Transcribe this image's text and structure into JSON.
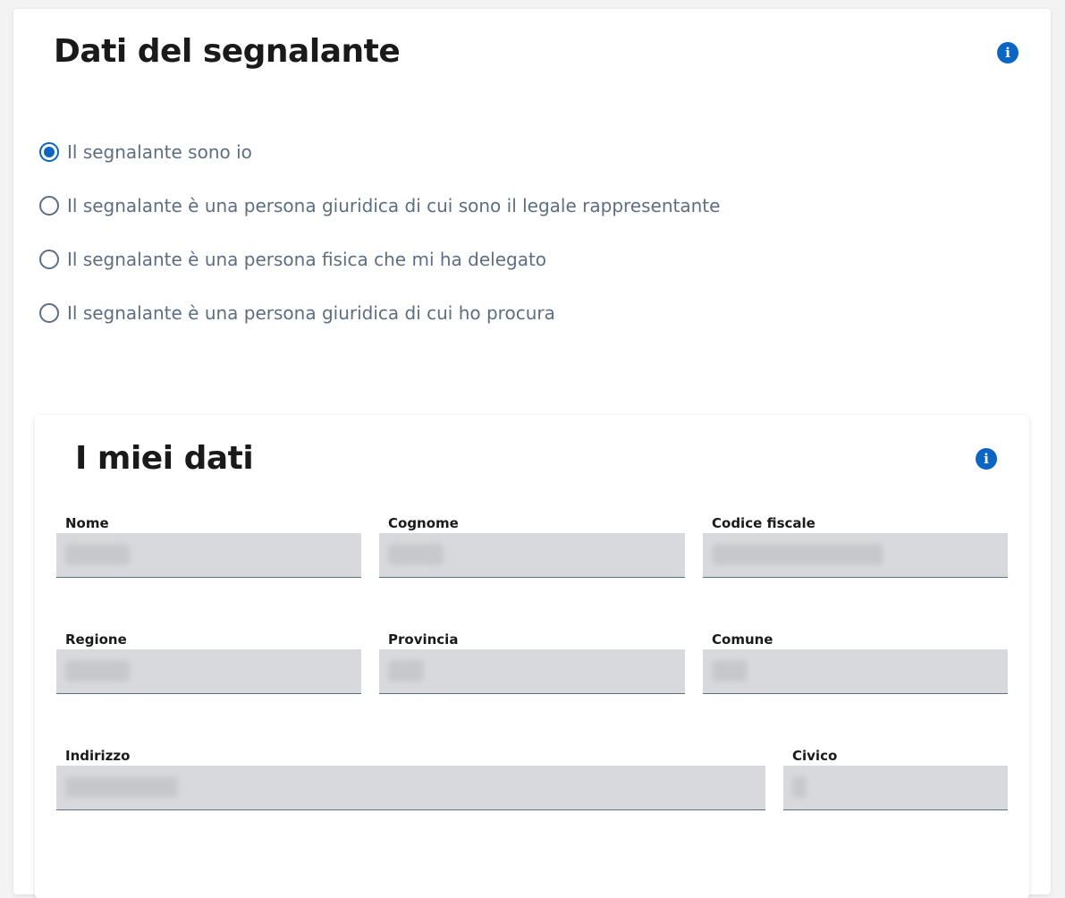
{
  "outer_section": {
    "title": "Dati del segnalante",
    "info_icon": "info-icon"
  },
  "reporter_options": [
    {
      "label": "Il segnalante sono io",
      "checked": true
    },
    {
      "label": "Il segnalante è una persona giuridica di cui sono il legale rappresentante",
      "checked": false
    },
    {
      "label": "Il segnalante è una persona fisica che mi ha delegato",
      "checked": false
    },
    {
      "label": "Il segnalante è una persona giuridica di cui ho procura",
      "checked": false
    }
  ],
  "my_data": {
    "title": "I miei dati",
    "info_icon": "info-icon",
    "fields": {
      "nome": {
        "label": "Nome"
      },
      "cognome": {
        "label": "Cognome"
      },
      "codice_fiscale": {
        "label": "Codice fiscale"
      },
      "regione": {
        "label": "Regione"
      },
      "provincia": {
        "label": "Provincia"
      },
      "comune": {
        "label": "Comune"
      },
      "indirizzo": {
        "label": "Indirizzo"
      },
      "civico": {
        "label": "Civico"
      }
    }
  },
  "colors": {
    "accent": "#0a66c2",
    "label_text": "#5c6f82",
    "input_bg": "#d8d9dc"
  }
}
